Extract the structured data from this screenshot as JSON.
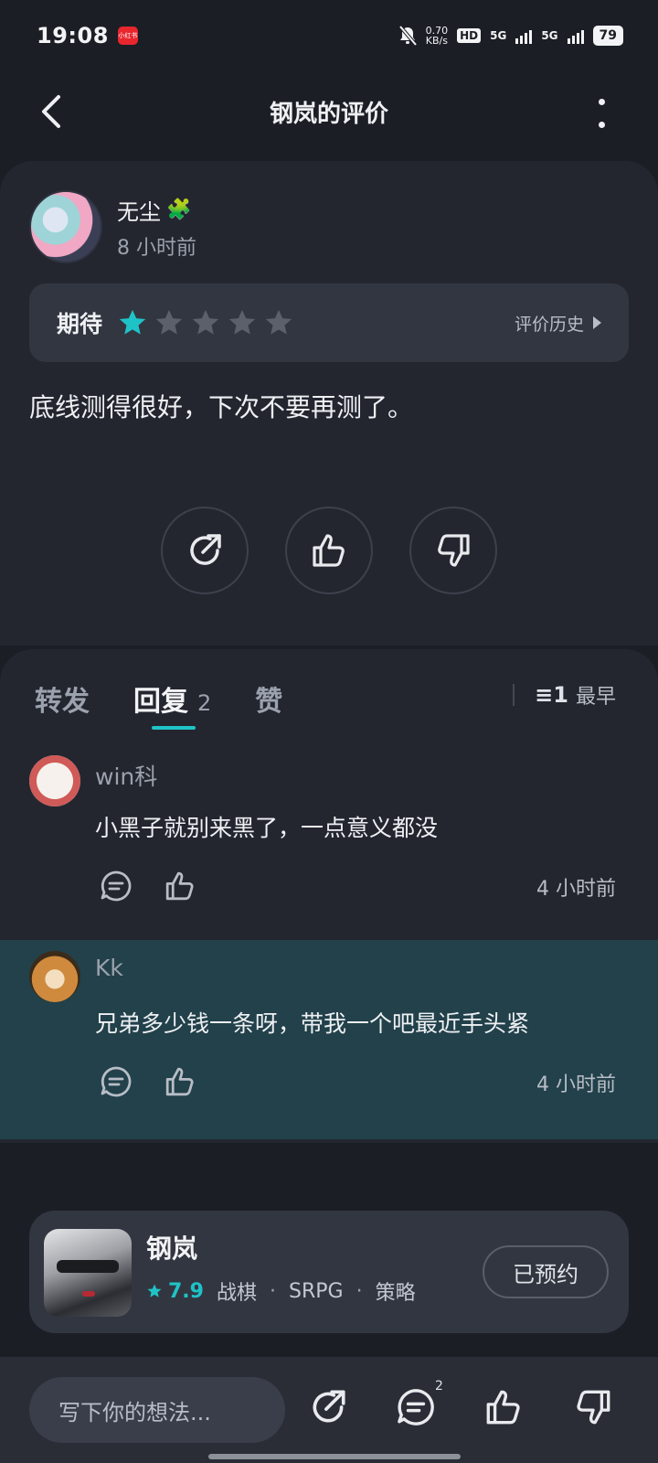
{
  "status_bar": {
    "time": "19:08",
    "app_badge": "小红书",
    "net_speed_value": "0.70",
    "net_speed_unit": "KB/s",
    "hd_label": "HD",
    "sim1_label": "5G",
    "sim2_label": "5G",
    "battery": "79"
  },
  "header": {
    "title": "钢岚的评价"
  },
  "review": {
    "author": "无尘",
    "author_badge": "🧩",
    "time_ago": "8 小时前",
    "rating_label": "期待",
    "rating_value": 1,
    "rating_max": 5,
    "history_link": "评价历史",
    "text": "底线测得很好，下次不要再测了。"
  },
  "tabs": {
    "forward": "转发",
    "reply": "回复",
    "reply_count": "2",
    "like": "赞",
    "sort_icon_text": "≡1",
    "sort_label": "最早"
  },
  "comments": [
    {
      "name": "win科",
      "text": "小黑子就别来黑了，一点意义都没",
      "time": "4 小时前"
    },
    {
      "name": "Kk",
      "text": "兄弟多少钱一条呀，带我一个吧最近手头紧",
      "time": "4 小时前"
    }
  ],
  "game": {
    "name": "钢岚",
    "score": "7.9",
    "tags": [
      "战棋",
      "SRPG",
      "策略"
    ],
    "tag_separator": "·",
    "reserve_label": "已预约"
  },
  "bottom_bar": {
    "compose_placeholder": "写下你的想法...",
    "comment_badge": "2"
  },
  "colors": {
    "accent": "#1fc3c7",
    "background": "#1b1e25",
    "card": "#23262f",
    "highlight_row": "#22414a"
  }
}
